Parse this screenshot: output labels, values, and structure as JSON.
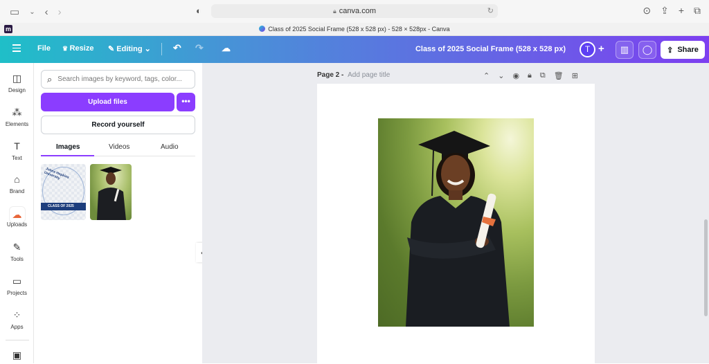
{
  "browser": {
    "url": "canva.com",
    "tab_title": "Class of 2025 Social Frame (528 x 528 px) - 528 × 528px - Canva"
  },
  "header": {
    "file": "File",
    "resize": "Resize",
    "editing": "Editing",
    "title": "Class of 2025 Social Frame (528 x 528 px)",
    "avatar_initial": "T",
    "share": "Share"
  },
  "rail": {
    "items": [
      {
        "label": "Design",
        "icon": "design-icon"
      },
      {
        "label": "Elements",
        "icon": "elements-icon"
      },
      {
        "label": "Text",
        "icon": "text-icon"
      },
      {
        "label": "Brand",
        "icon": "brand-icon"
      },
      {
        "label": "Uploads",
        "icon": "uploads-icon"
      },
      {
        "label": "Tools",
        "icon": "tools-icon"
      },
      {
        "label": "Projects",
        "icon": "projects-icon"
      },
      {
        "label": "Apps",
        "icon": "apps-icon"
      }
    ]
  },
  "panel": {
    "search_placeholder": "Search images by keyword, tags, color...",
    "upload_files": "Upload files",
    "more": "•••",
    "record_yourself": "Record yourself",
    "tabs": [
      "Images",
      "Videos",
      "Audio"
    ],
    "thumb1_arc": "Johns Hopkins University",
    "thumb1_banner": "CLASS OF 2025"
  },
  "canvas": {
    "page_label": "Page 2 -",
    "page_title_placeholder": "Add page title"
  },
  "colors": {
    "accent": "#8b3dff",
    "header_start": "#1fbfc8",
    "header_end": "#7d3ff0"
  }
}
